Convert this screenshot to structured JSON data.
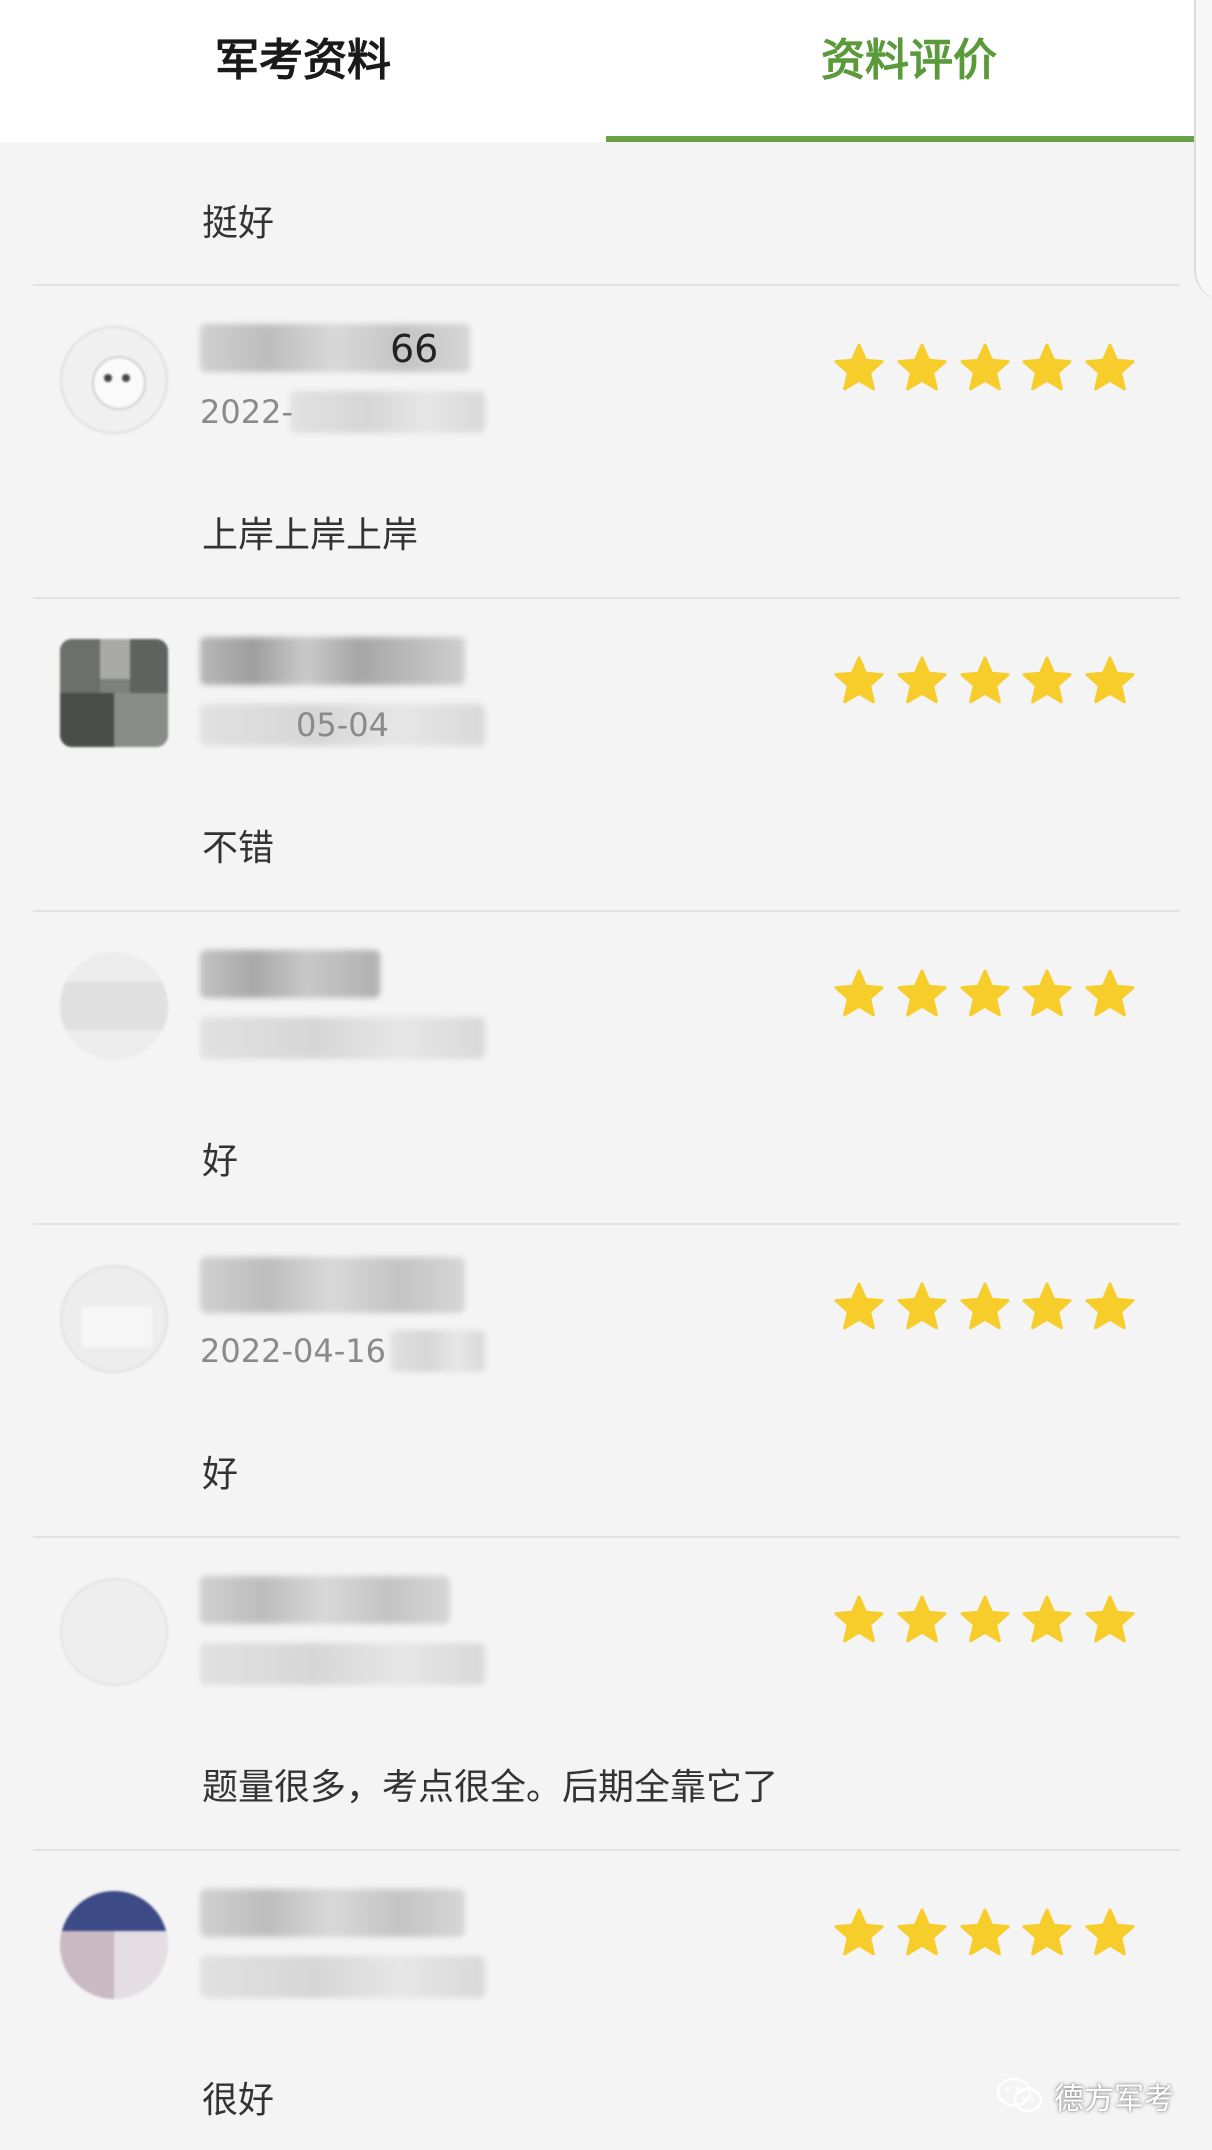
{
  "tabs": [
    {
      "label": "军考资料",
      "active": false
    },
    {
      "label": "资料评价",
      "active": true
    }
  ],
  "accent_color": "#6aa146",
  "star_color": "#f6cd2b",
  "reviews": [
    {
      "comment": "挺好",
      "rating": null,
      "name_visible": "",
      "date_visible": ""
    },
    {
      "comment": "上岸上岸上岸",
      "rating": 5,
      "name_visible": "66",
      "date_visible": "2022-"
    },
    {
      "comment": "不错",
      "rating": 5,
      "name_visible": "",
      "date_visible": "05-04"
    },
    {
      "comment": "好",
      "rating": 5,
      "name_visible": "",
      "date_visible": ""
    },
    {
      "comment": "好",
      "rating": 5,
      "name_visible": "",
      "date_visible": "2022-04-16"
    },
    {
      "comment": "题量很多，考点很全。后期全靠它了",
      "rating": 5,
      "name_visible": "",
      "date_visible": ""
    },
    {
      "comment": "很好",
      "rating": 5,
      "name_visible": "",
      "date_visible": ""
    }
  ],
  "watermark": {
    "text": "德方军考",
    "icon": "wechat-icon"
  }
}
